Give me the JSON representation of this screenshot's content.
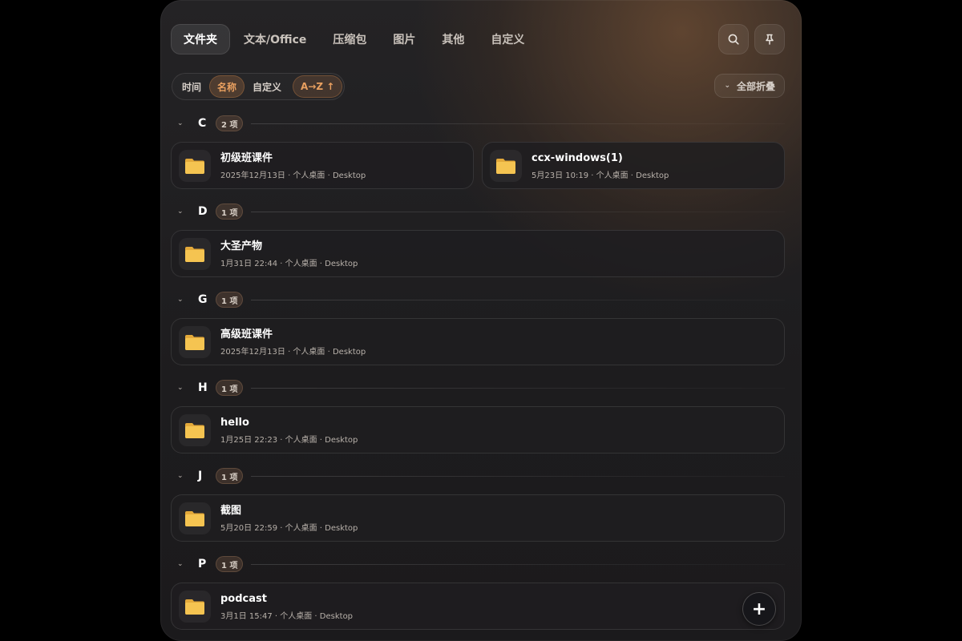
{
  "tabs": [
    {
      "label": "文件夹",
      "active": true
    },
    {
      "label": "文本/Office",
      "active": false
    },
    {
      "label": "压缩包",
      "active": false
    },
    {
      "label": "图片",
      "active": false
    },
    {
      "label": "其他",
      "active": false
    },
    {
      "label": "自定义",
      "active": false
    }
  ],
  "toolbar": {
    "search_icon": "search-icon",
    "pin_icon": "pin-icon"
  },
  "sort": {
    "options": [
      "时间",
      "名称",
      "自定义"
    ],
    "selected": "名称",
    "direction_label": "A→Z ↑"
  },
  "collapse_label": "全部折叠",
  "colors": {
    "accent": "#e9a060",
    "folder": "#f5c451"
  },
  "groups": [
    {
      "letter": "C",
      "count": "2 项",
      "items": [
        {
          "name": "初级班课件",
          "sub": "2025年12月13日 · 个人桌面 · Desktop"
        },
        {
          "name": "ccx-windows(1)",
          "sub": "5月23日 10:19 · 个人桌面 · Desktop"
        }
      ]
    },
    {
      "letter": "D",
      "count": "1 项",
      "items": [
        {
          "name": "大圣产物",
          "sub": "1月31日 22:44 · 个人桌面 · Desktop"
        }
      ]
    },
    {
      "letter": "G",
      "count": "1 项",
      "items": [
        {
          "name": "高级班课件",
          "sub": "2025年12月13日 · 个人桌面 · Desktop"
        }
      ]
    },
    {
      "letter": "H",
      "count": "1 项",
      "items": [
        {
          "name": "hello",
          "sub": "1月25日 22:23 · 个人桌面 · Desktop"
        }
      ]
    },
    {
      "letter": "J",
      "count": "1 项",
      "items": [
        {
          "name": "截图",
          "sub": "5月20日 22:59 · 个人桌面 · Desktop"
        }
      ]
    },
    {
      "letter": "P",
      "count": "1 项",
      "items": [
        {
          "name": "podcast",
          "sub": "3月1日 15:47 · 个人桌面 · Desktop"
        }
      ]
    }
  ],
  "fab_label": "+"
}
